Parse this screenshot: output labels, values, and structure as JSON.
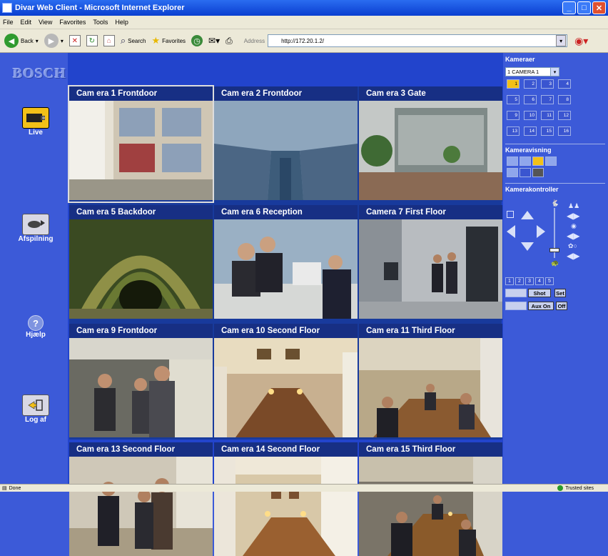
{
  "window": {
    "title": "Divar Web Client - Microsoft Internet Explorer"
  },
  "menu": [
    "File",
    "Edit",
    "View",
    "Favorites",
    "Tools",
    "Help"
  ],
  "toolbar": {
    "back": "Back",
    "search": "Search",
    "favorites": "Favorites",
    "address_label": "Address",
    "address_value": "http://172.20.1.2/"
  },
  "logo": "BOSCH",
  "nav": {
    "live": "Live",
    "playback": "Afspilning",
    "help": "Hjælp",
    "logout": "Log af"
  },
  "cameras": [
    {
      "title": "Cam era 1  Frontdoor"
    },
    {
      "title": "Cam era 2  Frontdoor"
    },
    {
      "title": "Cam era 3  Gate"
    },
    {
      "title": "Cam era 5  Backdoor"
    },
    {
      "title": "Cam era 6  Reception"
    },
    {
      "title": "Camera 7  First Floor"
    },
    {
      "title": "Cam era 9  Frontdoor"
    },
    {
      "title": "Cam era 10  Second Floor"
    },
    {
      "title": "Cam era 11  Third Floor"
    },
    {
      "title": "Cam era 13  Second Floor"
    },
    {
      "title": "Cam era 14  Second Floor"
    },
    {
      "title": "Cam era 15  Third Floor"
    }
  ],
  "right": {
    "cameras_label": "Kameraer",
    "camera_select": "1 CAMERA 1",
    "camera_buttons": [
      "1",
      "2",
      "3",
      "4",
      "5",
      "6",
      "7",
      "8",
      "9",
      "10",
      "11",
      "12",
      "13",
      "14",
      "15",
      "16"
    ],
    "view_label": "Kameravisning",
    "control_label": "Kamerakontroller",
    "presets": [
      "1",
      "2",
      "3",
      "4",
      "5"
    ],
    "shot": "Shot",
    "set": "Set",
    "aux_on": "Aux On",
    "off": "Off"
  },
  "status": {
    "left": "Done",
    "zone": "Trusted sites"
  }
}
